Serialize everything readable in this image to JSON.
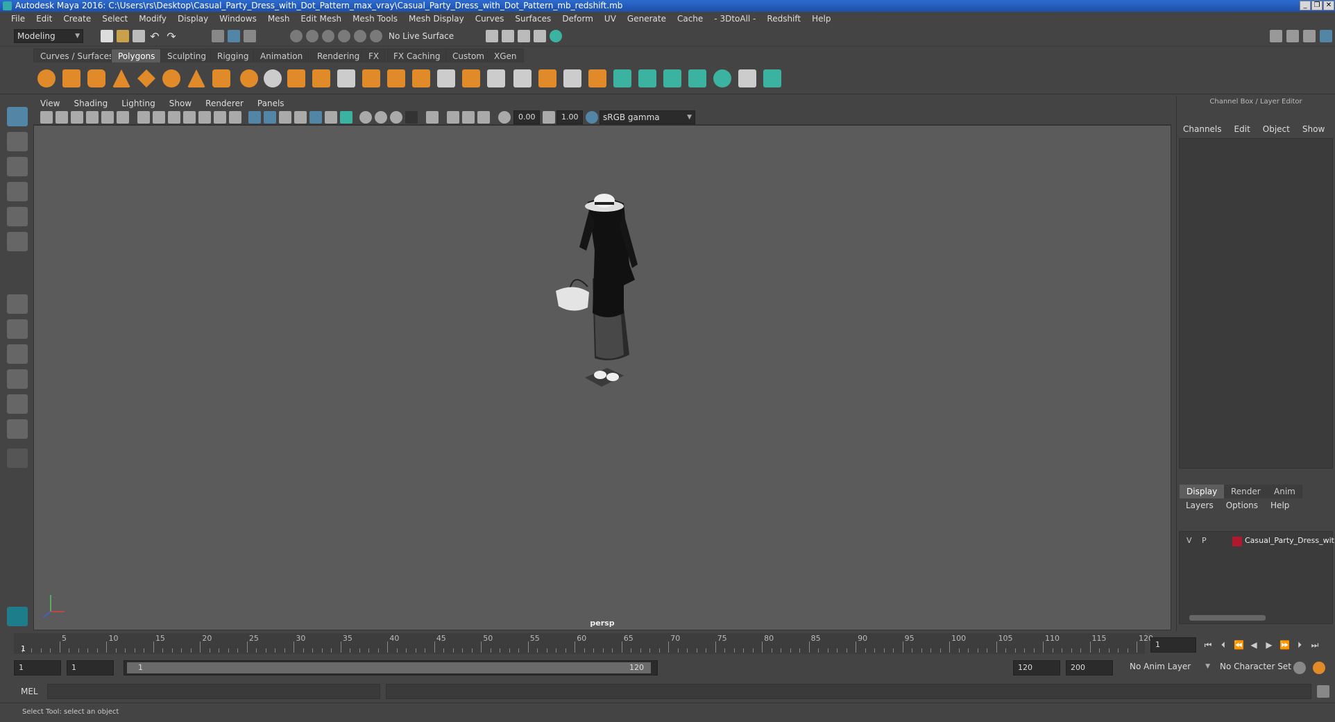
{
  "window": {
    "title": "Autodesk Maya 2016: C:\\Users\\rs\\Desktop\\Casual_Party_Dress_with_Dot_Pattern_max_vray\\Casual_Party_Dress_with_Dot_Pattern_mb_redshift.mb",
    "min": "_",
    "max": "❐",
    "close": "✕"
  },
  "menubar": [
    "File",
    "Edit",
    "Create",
    "Select",
    "Modify",
    "Display",
    "Windows",
    "Mesh",
    "Edit Mesh",
    "Mesh Tools",
    "Mesh Display",
    "Curves",
    "Surfaces",
    "Deform",
    "UV",
    "Generate",
    "Cache",
    "- 3DtoAll -",
    "Redshift",
    "Help"
  ],
  "statusline": {
    "mode": "Modeling",
    "live_surface": "No Live Surface"
  },
  "shelf_tabs": [
    {
      "label": "Curves / Surfaces",
      "active": false
    },
    {
      "label": "Polygons",
      "active": true
    },
    {
      "label": "Sculpting",
      "active": false
    },
    {
      "label": "Rigging",
      "active": false
    },
    {
      "label": "Animation",
      "active": false
    },
    {
      "label": "Rendering",
      "active": false
    },
    {
      "label": "FX",
      "active": false
    },
    {
      "label": "FX Caching",
      "active": false
    },
    {
      "label": "Custom",
      "active": false
    },
    {
      "label": "XGen",
      "active": false
    }
  ],
  "viewport": {
    "menus": [
      "View",
      "Shading",
      "Lighting",
      "Show",
      "Renderer",
      "Panels"
    ],
    "exposure": "0.00",
    "gamma": "1.00",
    "color_space": "sRGB gamma",
    "camera_label": "persp"
  },
  "right_panel": {
    "title": "Channel Box / Layer Editor",
    "menus": [
      "Channels",
      "Edit",
      "Object",
      "Show"
    ],
    "tabs": [
      {
        "label": "Display",
        "active": true
      },
      {
        "label": "Render",
        "active": false
      },
      {
        "label": "Anim",
        "active": false
      }
    ],
    "layer_menus": [
      "Layers",
      "Options",
      "Help"
    ],
    "layer": {
      "v": "V",
      "p": "P",
      "name": "Casual_Party_Dress_with",
      "color": "#b01830"
    }
  },
  "timeline": {
    "ticks": [
      "5",
      "10",
      "15",
      "20",
      "25",
      "30",
      "35",
      "40",
      "45",
      "50",
      "55",
      "60",
      "65",
      "70",
      "75",
      "80",
      "85",
      "90",
      "95",
      "100",
      "105",
      "110",
      "115",
      "120"
    ],
    "start_marker": "1",
    "current_frame": "1"
  },
  "range": {
    "start": "1",
    "playback_start": "1",
    "slider_start": "1",
    "slider_end": "120",
    "playback_end": "120",
    "end": "200",
    "anim_layer": "No Anim Layer",
    "character_set": "No Character Set"
  },
  "command": {
    "lang": "MEL"
  },
  "help_line": "Select Tool: select an object",
  "colors": {
    "accent": "#5285a6",
    "shelf_orange": "#e08a2a",
    "shelf_teal": "#3bb3a0"
  }
}
